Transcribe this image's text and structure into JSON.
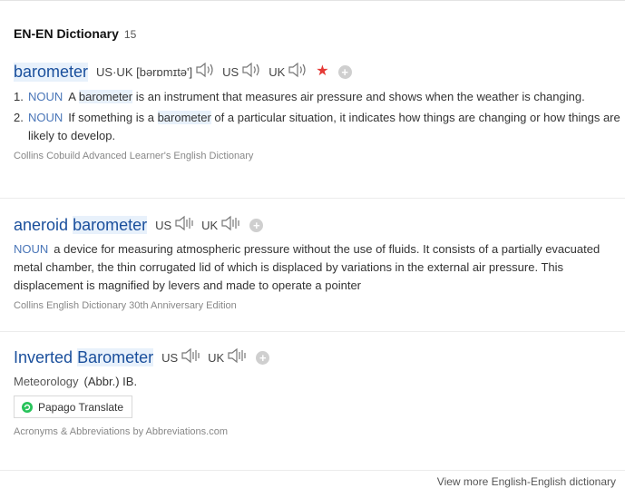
{
  "header": {
    "title": "EN-EN Dictionary",
    "count": "15"
  },
  "entries": [
    {
      "word": "barometer",
      "pronunciation": "US·UK [bərɒmɪtə']",
      "us_label": "US",
      "uk_label": "UK",
      "starred": true,
      "definitions": [
        {
          "num": "1.",
          "pos": "NOUN",
          "pre": "A ",
          "hl": "barometer",
          "post": " is an instrument that measures air pressure and shows when the weather is changing."
        },
        {
          "num": "2.",
          "pos": "NOUN",
          "pre": "If something is a ",
          "hl": "barometer",
          "post": " of a particular situation, it indicates how things are changing or how things are likely to develop."
        }
      ],
      "source": "Collins Cobuild Advanced Learner's English Dictionary"
    },
    {
      "word_part1": "aneroid",
      "word_part2": "barometer",
      "us_label": "US",
      "uk_label": "UK",
      "pos": "NOUN",
      "definition": "a device for measuring atmospheric pressure without the use of fluids. It consists of a partially evacuated metal chamber, the thin corrugated lid of which is displaced by variations in the external air pressure. This displacement is magnified by levers and made to operate a pointer",
      "source": "Collins English Dictionary 30th Anniversary Edition"
    },
    {
      "word_part1": "Inverted",
      "word_part2": "Barometer",
      "us_label": "US",
      "uk_label": "UK",
      "category": "Meteorology",
      "abbr": "(Abbr.) IB.",
      "button": "Papago Translate",
      "source": "Acronyms & Abbreviations by Abbreviations.com"
    }
  ],
  "footer": {
    "more_link": "View more English-English dictionary"
  },
  "colors": {
    "headword": "#1a4f9c",
    "highlight": "#e8f1fb",
    "pos": "#4a76b8",
    "star": "#e53935"
  },
  "icons": [
    "speaker-icon",
    "star-icon",
    "plus-icon",
    "papago-icon"
  ]
}
